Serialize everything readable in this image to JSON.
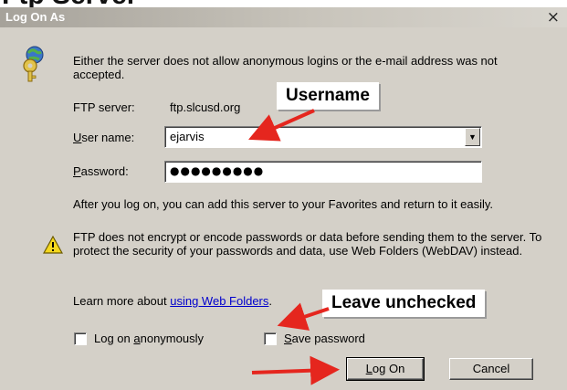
{
  "window": {
    "cut_title": "Ftp Server",
    "title": "Log On As",
    "close_glyph": "×"
  },
  "message": {
    "icon": "key-globe-icon",
    "text": "Either the server does not allow anonymous logins or the e-mail address was not accepted."
  },
  "ftp_server": {
    "label": "FTP server:",
    "value": "ftp.slcusd.org"
  },
  "username": {
    "label_u": "U",
    "label_rest": "ser name:",
    "value": "ejarvis"
  },
  "password": {
    "label_p": "P",
    "label_rest": "assword:",
    "masked": "●●●●●●●●●"
  },
  "favorites_note": "After you log on, you can add this server to your Favorites and return to it easily.",
  "warning": {
    "icon": "warning-icon",
    "text": "FTP does not encrypt or encode passwords or data before sending them to the server.  To protect the security of your passwords and data, use Web Folders (WebDAV) instead."
  },
  "learn_more": {
    "prefix": "Learn more about ",
    "link": "using Web Folders",
    "suffix": "."
  },
  "checkboxes": {
    "anon_pre": "Log on ",
    "anon_u": "a",
    "anon_post": "nonymously",
    "anon_checked": false,
    "save_u": "S",
    "save_post": "ave password",
    "save_checked": false
  },
  "buttons": {
    "logon_u": "L",
    "logon_rest": "og On",
    "cancel": "Cancel"
  },
  "annotations": {
    "username_callout": "Username",
    "leave_unchecked_callout": "Leave unchecked",
    "arrow_color": "#e5261e"
  }
}
